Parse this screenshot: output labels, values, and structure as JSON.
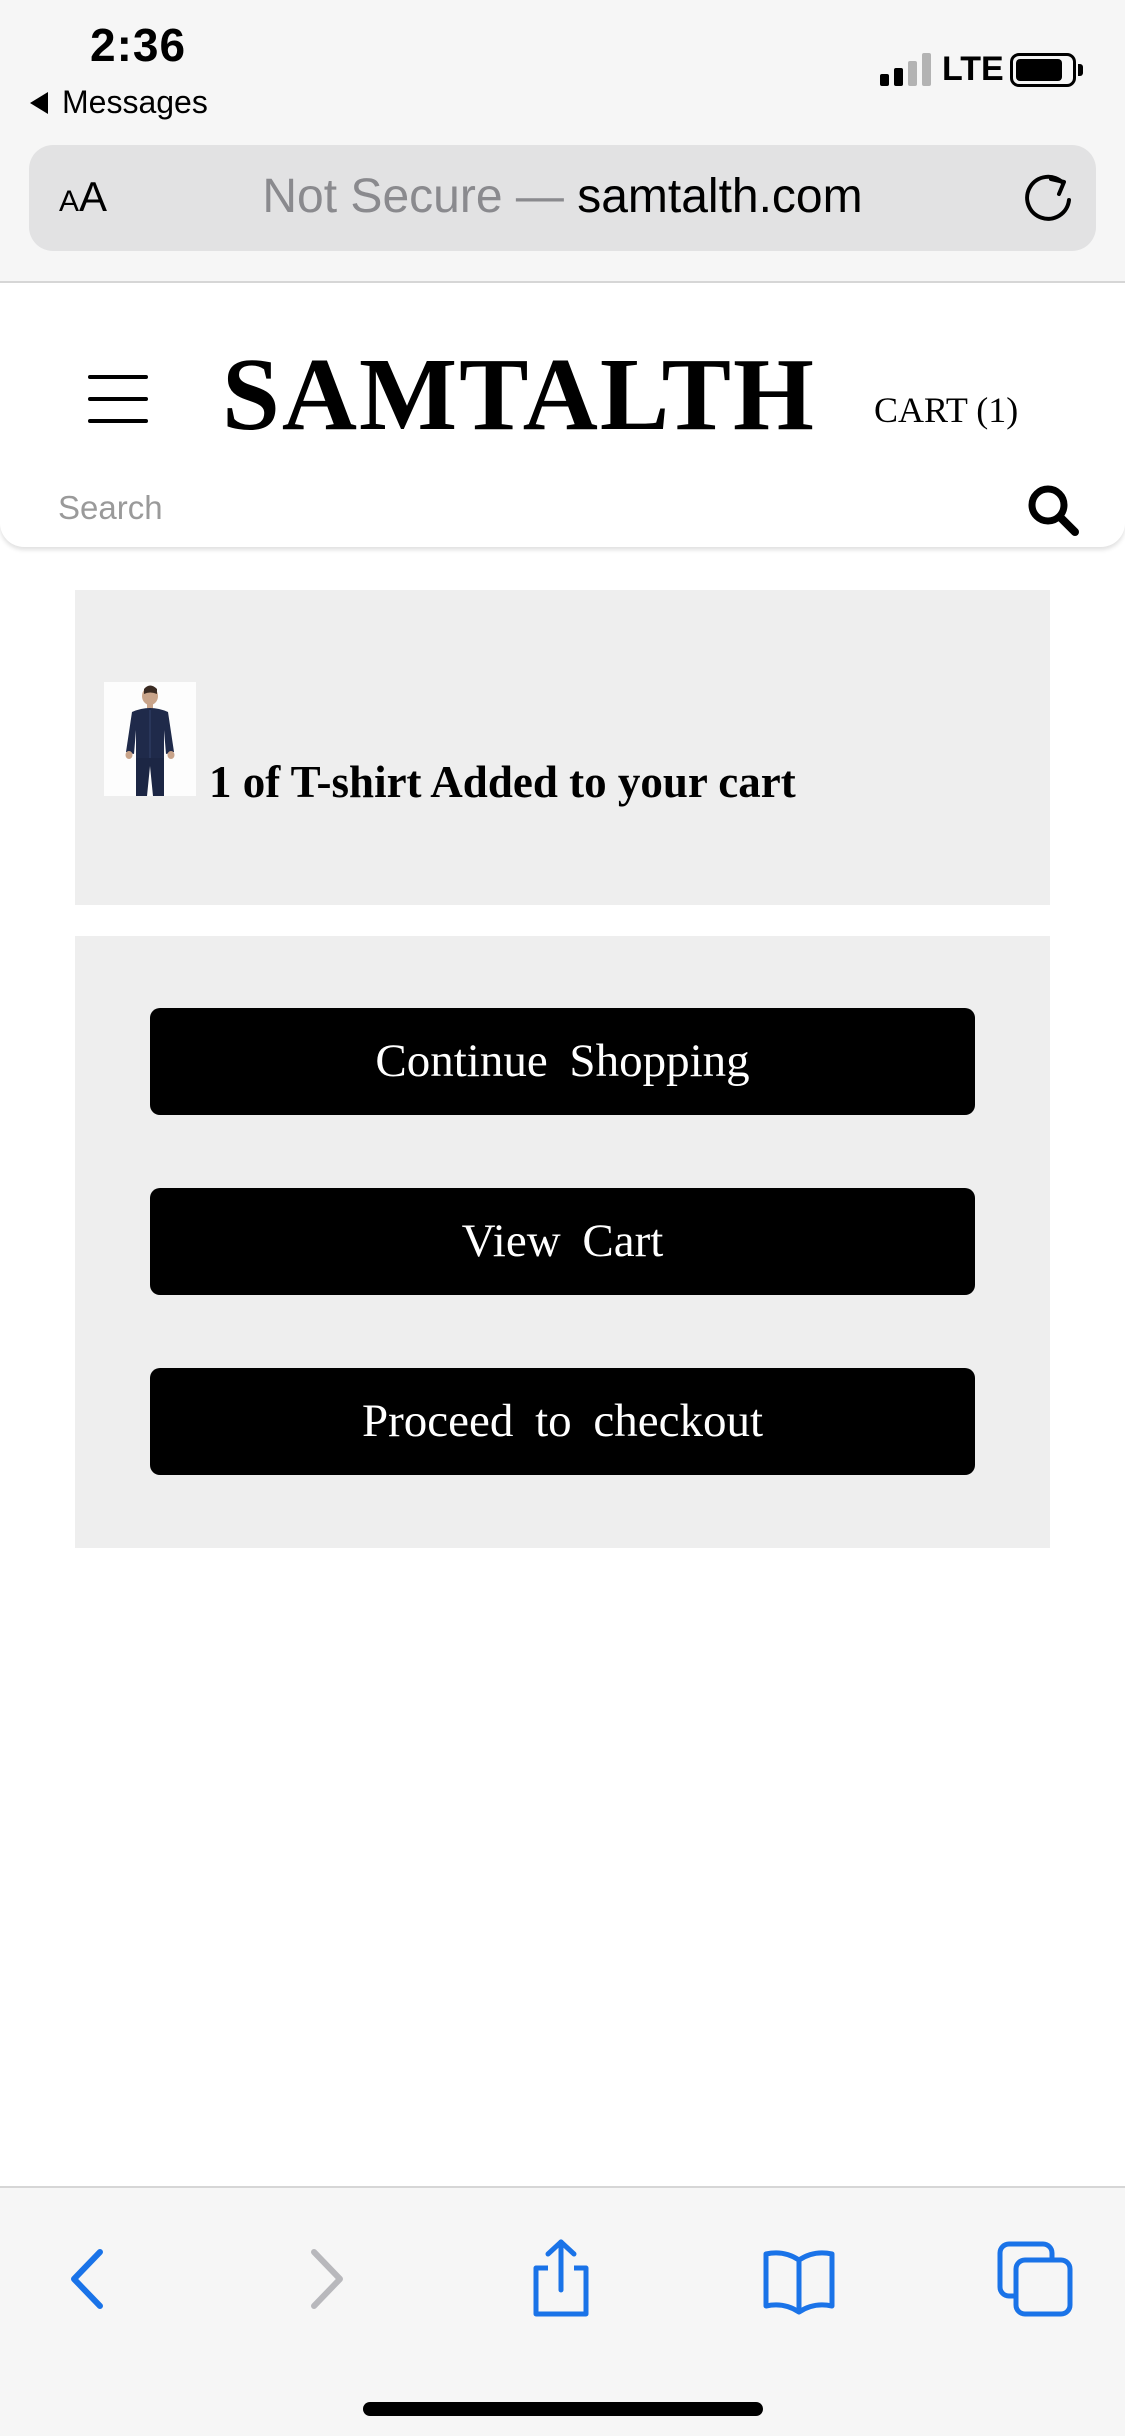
{
  "status_bar": {
    "time": "2:36",
    "back_app": "Messages",
    "network": "LTE"
  },
  "browser": {
    "aa_small": "A",
    "aa_big": "A",
    "url_security": "Not Secure —",
    "url_domain": "samtalth.com",
    "toolbar_icons": [
      "back-icon",
      "forward-icon",
      "share-icon",
      "bookmarks-icon",
      "tabs-icon"
    ]
  },
  "site": {
    "brand": "SAMTALTH",
    "cart_label": "CART (1)",
    "search_placeholder": "Search"
  },
  "confirmation": {
    "message": "1 of T-shirt Added to your cart"
  },
  "actions": {
    "continue_label": "Continue Shopping",
    "view_cart_label": "View Cart",
    "checkout_label": "Proceed to checkout"
  },
  "colors": {
    "ios_blue": "#1a73e8",
    "panel_gray": "#eeeeee",
    "button_black": "#000000",
    "chrome_gray": "#f6f6f6"
  }
}
